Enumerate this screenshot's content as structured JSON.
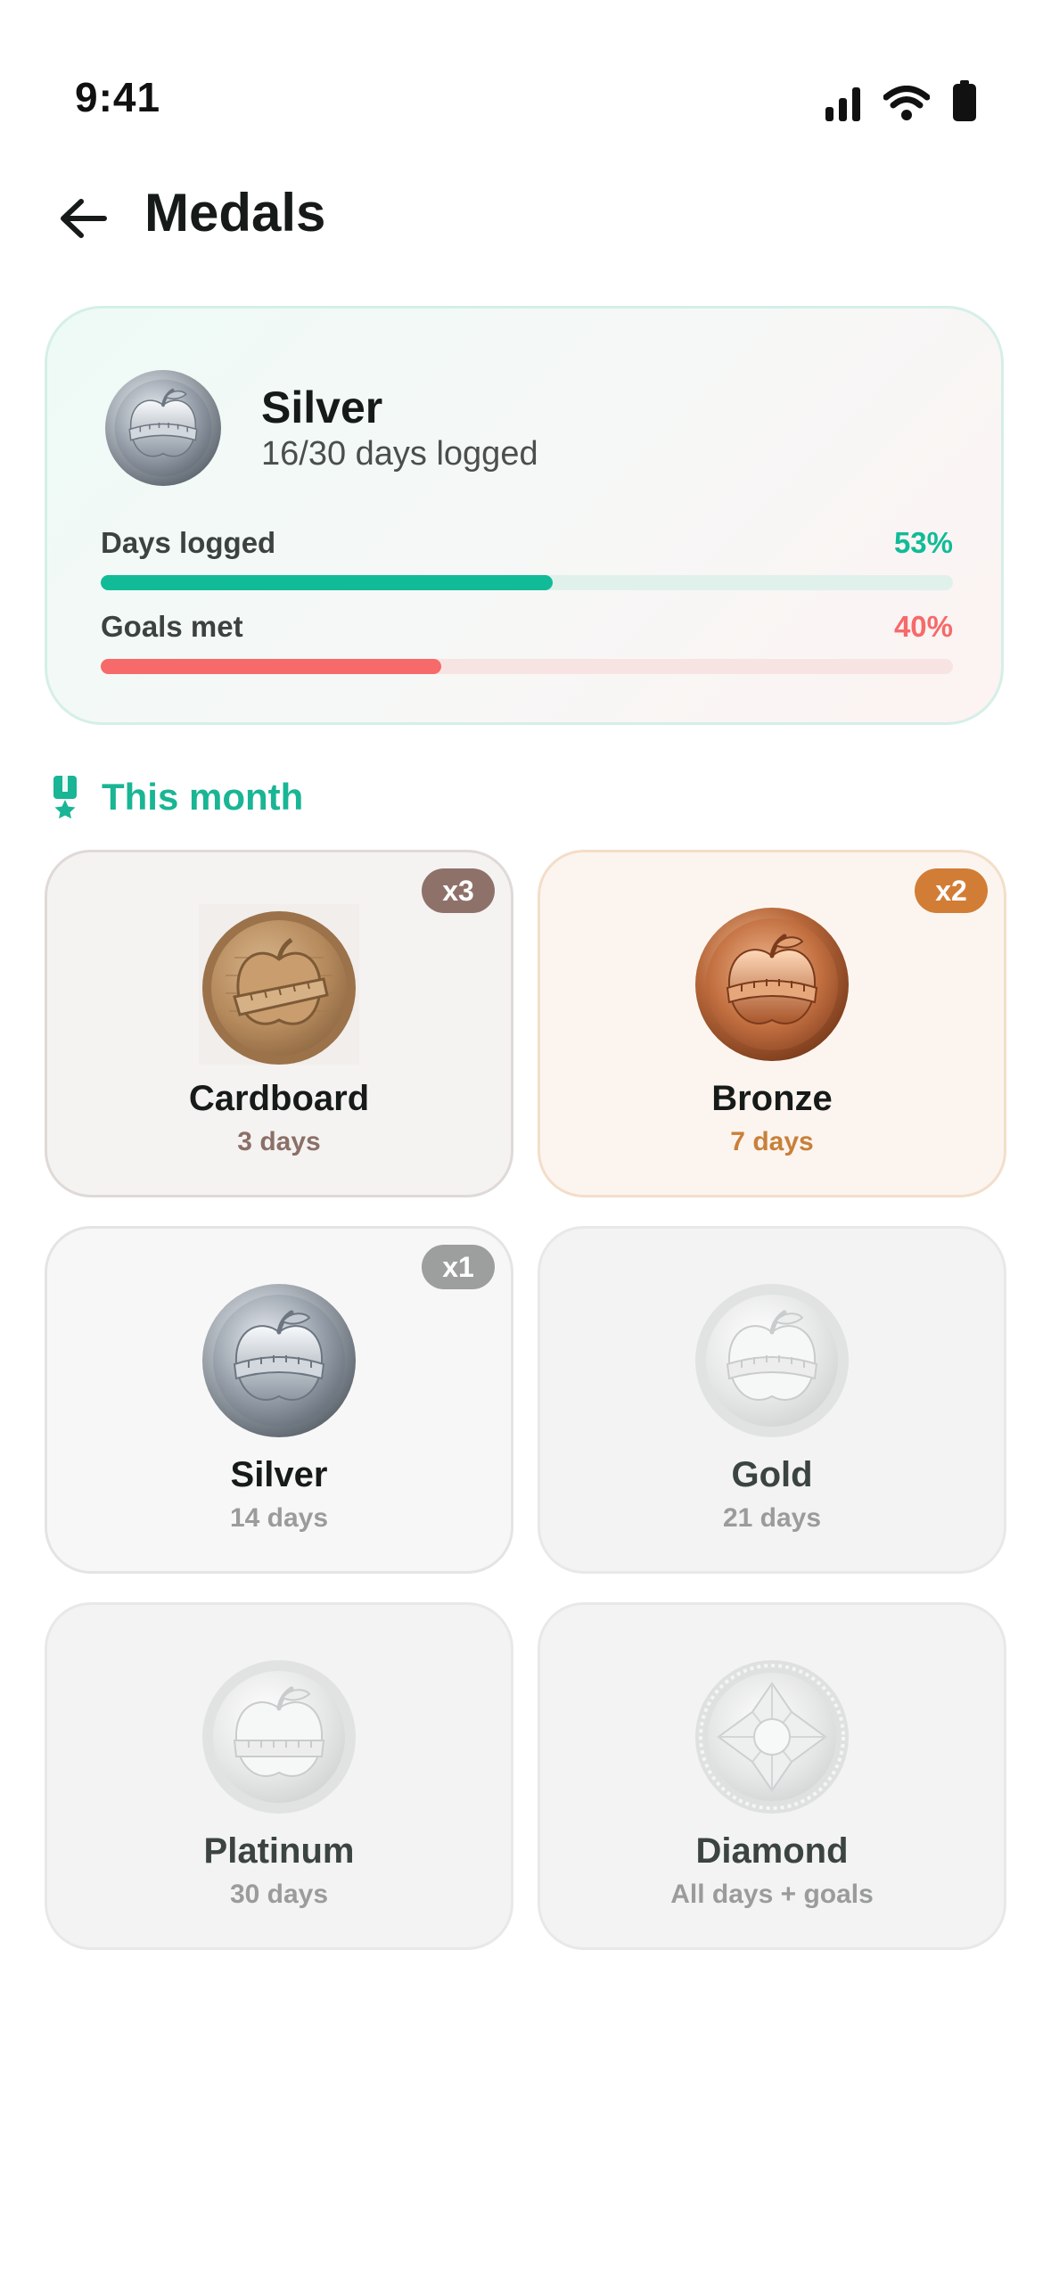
{
  "status_bar": {
    "time": "9:41"
  },
  "header": {
    "title": "Medals"
  },
  "summary": {
    "medal": "Silver",
    "subtitle": "16/30 days logged",
    "progress": [
      {
        "label": "Days logged",
        "value_text": "53%",
        "fraction": 0.53,
        "color": "#12bb98",
        "track_color": "#e0f1ec"
      },
      {
        "label": "Goals met",
        "value_text": "40%",
        "fraction": 0.4,
        "color": "#f66a6a",
        "track_color": "#f7e4e2"
      }
    ]
  },
  "section": {
    "title": "This month",
    "icon": "medal-ribbon-icon"
  },
  "medals": [
    {
      "name": "Cardboard",
      "requirement": "3 days",
      "count": "x3",
      "earned": true,
      "badge_color": "#8e726a",
      "req_color": "#8b7068",
      "card_bg": "#f5f3f2",
      "card_border": "#dfd9d7"
    },
    {
      "name": "Bronze",
      "requirement": "7 days",
      "count": "x2",
      "earned": true,
      "badge_color": "#d27d36",
      "req_color": "#c98039",
      "card_bg": "#fcf5ef",
      "card_border": "#f3dec9"
    },
    {
      "name": "Silver",
      "requirement": "14 days",
      "count": "x1",
      "earned": true,
      "badge_color": "#9d9e9e",
      "req_color": "#9a9c9b",
      "card_bg": "#f7f7f7",
      "card_border": "#e3e5e4"
    },
    {
      "name": "Gold",
      "requirement": "21 days",
      "count": "",
      "earned": false,
      "badge_color": "",
      "req_color": "#9a9c9b",
      "card_bg": "#f2f3f2",
      "card_border": "#e7e9e8"
    },
    {
      "name": "Platinum",
      "requirement": "30 days",
      "count": "",
      "earned": false,
      "badge_color": "",
      "req_color": "#9a9c9b",
      "card_bg": "#f2f3f2",
      "card_border": "#e7e9e8"
    },
    {
      "name": "Diamond",
      "requirement": "All days + goals",
      "count": "",
      "earned": false,
      "badge_color": "",
      "req_color": "#9a9c9b",
      "card_bg": "#f2f3f2",
      "card_border": "#e7e9e8"
    }
  ]
}
